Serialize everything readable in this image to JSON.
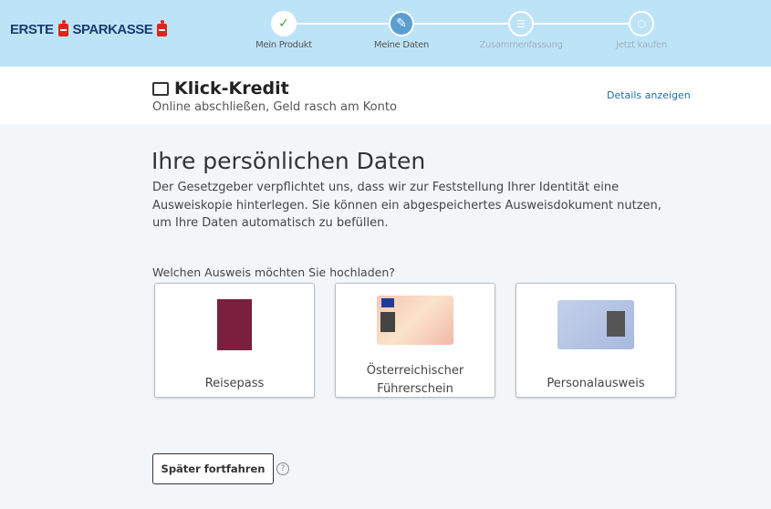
{
  "brand": {
    "part1": "ERSTE",
    "part2": "SPARKASSE"
  },
  "steps": [
    {
      "label": "Mein Produkt",
      "state": "done",
      "icon": "check-icon"
    },
    {
      "label": "Meine Daten",
      "state": "active",
      "icon": "pencil-icon"
    },
    {
      "label": "Zusammenfassung",
      "state": "upcoming",
      "icon": "list-icon"
    },
    {
      "label": "Jetzt kaufen",
      "state": "upcoming",
      "icon": "box-icon"
    }
  ],
  "product": {
    "title": "Klick-Kredit",
    "subtitle": "Online abschließen, Geld rasch am Konto",
    "details_link": "Details anzeigen",
    "icon": "wallet-icon"
  },
  "main": {
    "heading": "Ihre persönlichen Daten",
    "intro": "Der Gesetzgeber verpflichtet uns, dass wir zur Feststellung Ihrer Identität eine Ausweiskopie hinterlegen. Sie können ein abgespeichertes Ausweisdokument nutzen, um Ihre Daten automatisch zu befüllen.",
    "question": "Welchen Ausweis möchten Sie hochladen?",
    "options": [
      {
        "label": "Reisepass"
      },
      {
        "label": "Österreichischer Führerschein"
      },
      {
        "label": "Personalausweis"
      }
    ],
    "later_button": "Später fortfahren",
    "help": "?"
  },
  "colors": {
    "header_bg": "#bde3f7",
    "active_step": "#5b9fd1",
    "check": "#3aaa35",
    "link": "#1f6ea8",
    "brand_red": "#e2231a",
    "brand_blue": "#1a3c6e"
  }
}
